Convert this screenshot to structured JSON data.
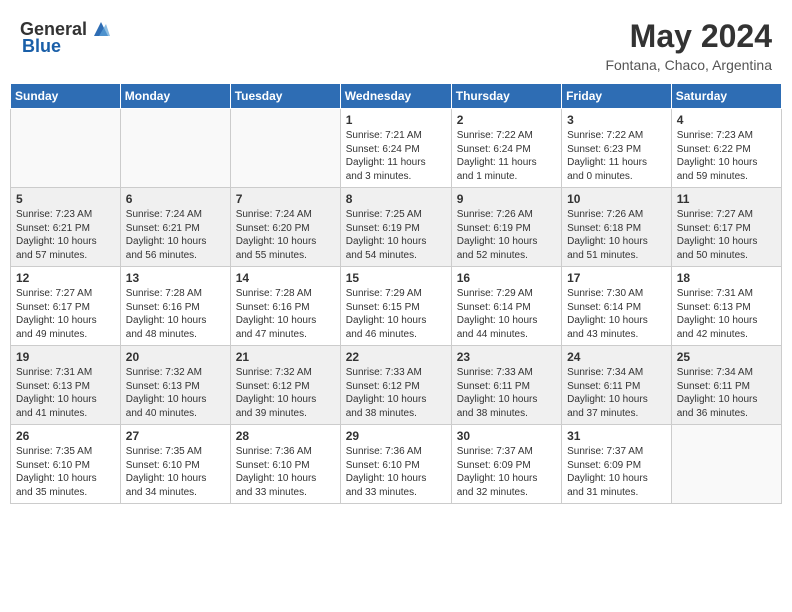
{
  "header": {
    "logo_general": "General",
    "logo_blue": "Blue",
    "month_year": "May 2024",
    "location": "Fontana, Chaco, Argentina"
  },
  "days_of_week": [
    "Sunday",
    "Monday",
    "Tuesday",
    "Wednesday",
    "Thursday",
    "Friday",
    "Saturday"
  ],
  "weeks": [
    {
      "shaded": false,
      "days": [
        {
          "num": "",
          "info": ""
        },
        {
          "num": "",
          "info": ""
        },
        {
          "num": "",
          "info": ""
        },
        {
          "num": "1",
          "info": "Sunrise: 7:21 AM\nSunset: 6:24 PM\nDaylight: 11 hours\nand 3 minutes."
        },
        {
          "num": "2",
          "info": "Sunrise: 7:22 AM\nSunset: 6:24 PM\nDaylight: 11 hours\nand 1 minute."
        },
        {
          "num": "3",
          "info": "Sunrise: 7:22 AM\nSunset: 6:23 PM\nDaylight: 11 hours\nand 0 minutes."
        },
        {
          "num": "4",
          "info": "Sunrise: 7:23 AM\nSunset: 6:22 PM\nDaylight: 10 hours\nand 59 minutes."
        }
      ]
    },
    {
      "shaded": true,
      "days": [
        {
          "num": "5",
          "info": "Sunrise: 7:23 AM\nSunset: 6:21 PM\nDaylight: 10 hours\nand 57 minutes."
        },
        {
          "num": "6",
          "info": "Sunrise: 7:24 AM\nSunset: 6:21 PM\nDaylight: 10 hours\nand 56 minutes."
        },
        {
          "num": "7",
          "info": "Sunrise: 7:24 AM\nSunset: 6:20 PM\nDaylight: 10 hours\nand 55 minutes."
        },
        {
          "num": "8",
          "info": "Sunrise: 7:25 AM\nSunset: 6:19 PM\nDaylight: 10 hours\nand 54 minutes."
        },
        {
          "num": "9",
          "info": "Sunrise: 7:26 AM\nSunset: 6:19 PM\nDaylight: 10 hours\nand 52 minutes."
        },
        {
          "num": "10",
          "info": "Sunrise: 7:26 AM\nSunset: 6:18 PM\nDaylight: 10 hours\nand 51 minutes."
        },
        {
          "num": "11",
          "info": "Sunrise: 7:27 AM\nSunset: 6:17 PM\nDaylight: 10 hours\nand 50 minutes."
        }
      ]
    },
    {
      "shaded": false,
      "days": [
        {
          "num": "12",
          "info": "Sunrise: 7:27 AM\nSunset: 6:17 PM\nDaylight: 10 hours\nand 49 minutes."
        },
        {
          "num": "13",
          "info": "Sunrise: 7:28 AM\nSunset: 6:16 PM\nDaylight: 10 hours\nand 48 minutes."
        },
        {
          "num": "14",
          "info": "Sunrise: 7:28 AM\nSunset: 6:16 PM\nDaylight: 10 hours\nand 47 minutes."
        },
        {
          "num": "15",
          "info": "Sunrise: 7:29 AM\nSunset: 6:15 PM\nDaylight: 10 hours\nand 46 minutes."
        },
        {
          "num": "16",
          "info": "Sunrise: 7:29 AM\nSunset: 6:14 PM\nDaylight: 10 hours\nand 44 minutes."
        },
        {
          "num": "17",
          "info": "Sunrise: 7:30 AM\nSunset: 6:14 PM\nDaylight: 10 hours\nand 43 minutes."
        },
        {
          "num": "18",
          "info": "Sunrise: 7:31 AM\nSunset: 6:13 PM\nDaylight: 10 hours\nand 42 minutes."
        }
      ]
    },
    {
      "shaded": true,
      "days": [
        {
          "num": "19",
          "info": "Sunrise: 7:31 AM\nSunset: 6:13 PM\nDaylight: 10 hours\nand 41 minutes."
        },
        {
          "num": "20",
          "info": "Sunrise: 7:32 AM\nSunset: 6:13 PM\nDaylight: 10 hours\nand 40 minutes."
        },
        {
          "num": "21",
          "info": "Sunrise: 7:32 AM\nSunset: 6:12 PM\nDaylight: 10 hours\nand 39 minutes."
        },
        {
          "num": "22",
          "info": "Sunrise: 7:33 AM\nSunset: 6:12 PM\nDaylight: 10 hours\nand 38 minutes."
        },
        {
          "num": "23",
          "info": "Sunrise: 7:33 AM\nSunset: 6:11 PM\nDaylight: 10 hours\nand 38 minutes."
        },
        {
          "num": "24",
          "info": "Sunrise: 7:34 AM\nSunset: 6:11 PM\nDaylight: 10 hours\nand 37 minutes."
        },
        {
          "num": "25",
          "info": "Sunrise: 7:34 AM\nSunset: 6:11 PM\nDaylight: 10 hours\nand 36 minutes."
        }
      ]
    },
    {
      "shaded": false,
      "days": [
        {
          "num": "26",
          "info": "Sunrise: 7:35 AM\nSunset: 6:10 PM\nDaylight: 10 hours\nand 35 minutes."
        },
        {
          "num": "27",
          "info": "Sunrise: 7:35 AM\nSunset: 6:10 PM\nDaylight: 10 hours\nand 34 minutes."
        },
        {
          "num": "28",
          "info": "Sunrise: 7:36 AM\nSunset: 6:10 PM\nDaylight: 10 hours\nand 33 minutes."
        },
        {
          "num": "29",
          "info": "Sunrise: 7:36 AM\nSunset: 6:10 PM\nDaylight: 10 hours\nand 33 minutes."
        },
        {
          "num": "30",
          "info": "Sunrise: 7:37 AM\nSunset: 6:09 PM\nDaylight: 10 hours\nand 32 minutes."
        },
        {
          "num": "31",
          "info": "Sunrise: 7:37 AM\nSunset: 6:09 PM\nDaylight: 10 hours\nand 31 minutes."
        },
        {
          "num": "",
          "info": ""
        }
      ]
    }
  ]
}
